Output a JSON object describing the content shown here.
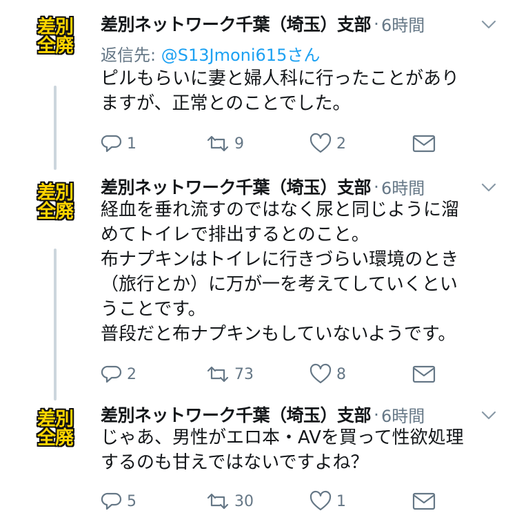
{
  "avatar": {
    "line1": "差別",
    "line2": "全廃"
  },
  "tweets": [
    {
      "name": "差別ネットワーク千葉（埼玉）支部",
      "time": "6時間",
      "reply_label": "返信先:",
      "reply_handle": "@S13Jmoni615さん",
      "lines": [
        "ピルもらいに妻と婦人科に行ったことがあり",
        "ますが、正常とのことでした。"
      ],
      "replies": "1",
      "retweets": "9",
      "likes": "2"
    },
    {
      "name": "差別ネットワーク千葉（埼玉）支部",
      "time": "6時間",
      "lines": [
        "経血を垂れ流すのではなく尿と同じように溜",
        "めてトイレで排出するとのこと。",
        "布ナプキンはトイレに行きづらい環境のとき",
        "（旅行とか）に万が一を考えてしていくとい",
        "うことです。",
        "普段だと布ナプキンもしていないようです。"
      ],
      "replies": "2",
      "retweets": "73",
      "likes": "8"
    },
    {
      "name": "差別ネットワーク千葉（埼玉）支部",
      "time": "6時間",
      "lines": [
        "じゃあ、男性がエロ本・AVを買って性欲処理",
        "するのも甘えではないですよね？"
      ],
      "replies": "5",
      "retweets": "30",
      "likes": "1"
    }
  ],
  "colors": {
    "meta": "#657786",
    "link": "#1da1f2",
    "line": "#ccd6dd",
    "avatar_text": "#ffd500"
  },
  "icons": [
    "reply-icon",
    "retweet-icon",
    "like-icon",
    "message-icon",
    "chevron-down-icon"
  ]
}
